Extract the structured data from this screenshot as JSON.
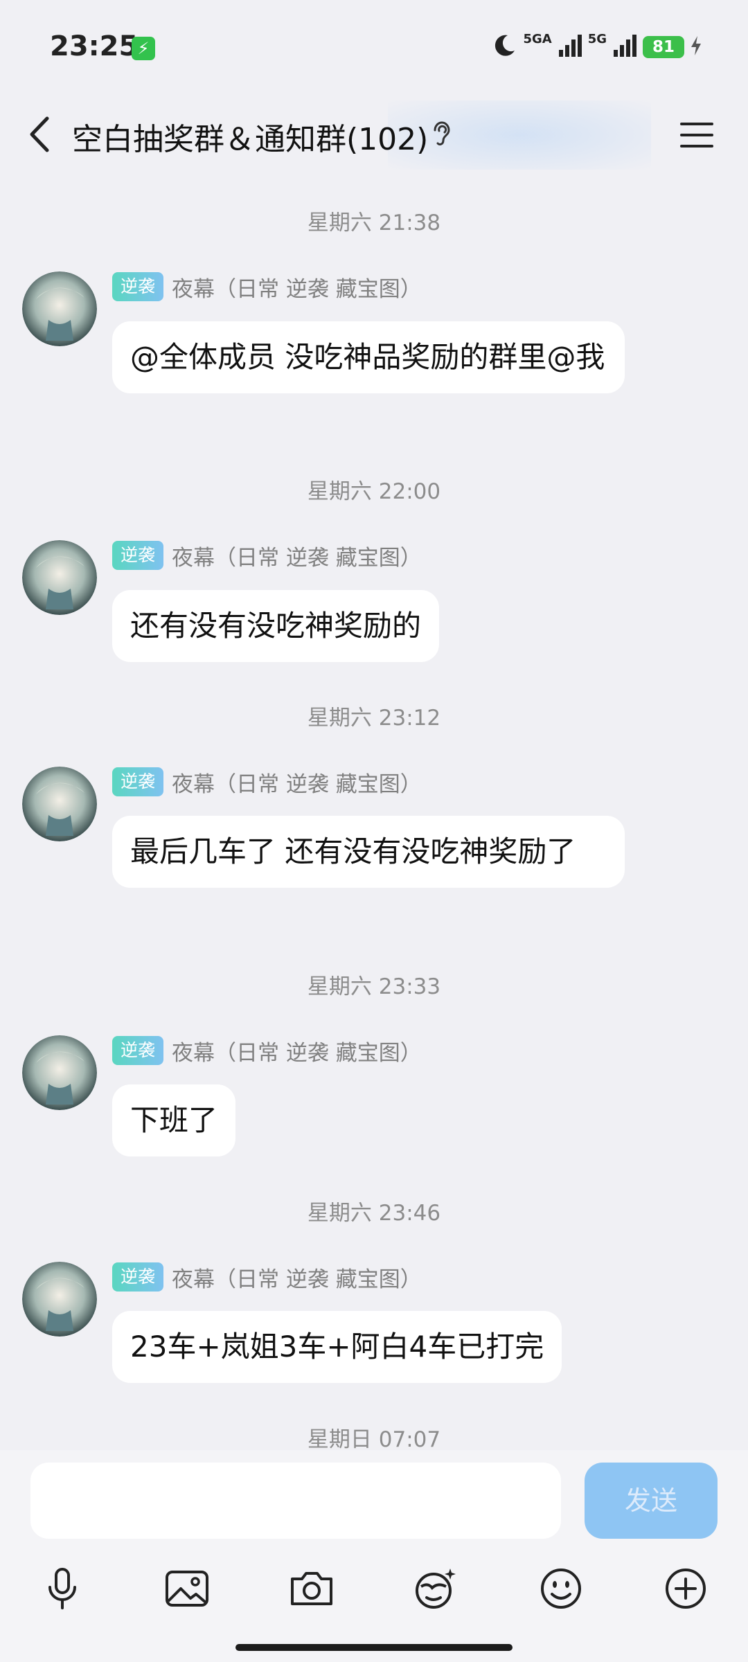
{
  "status_bar": {
    "time": "23:25",
    "signal1_label": "5GA",
    "signal2_label": "5G",
    "battery": "81"
  },
  "header": {
    "title": "空白抽奖群＆通知群(102)"
  },
  "messages": [
    {
      "timestamp": "星期六 21:38",
      "badge": "逆袭",
      "sender": "夜幕（日常 逆袭 藏宝图）",
      "text": "@全体成员 没吃神品奖励的群里@我"
    },
    {
      "timestamp": "星期六 22:00",
      "badge": "逆袭",
      "sender": "夜幕（日常 逆袭 藏宝图）",
      "text": "还有没有没吃神奖励的"
    },
    {
      "timestamp": "星期六 23:12",
      "badge": "逆袭",
      "sender": "夜幕（日常 逆袭 藏宝图）",
      "text": "最后几车了 还有没有没吃神奖励了"
    },
    {
      "timestamp": "星期六 23:33",
      "badge": "逆袭",
      "sender": "夜幕（日常 逆袭 藏宝图）",
      "text": "下班了"
    },
    {
      "timestamp": "星期六 23:46",
      "badge": "逆袭",
      "sender": "夜幕（日常 逆袭 藏宝图）",
      "text": "23车+岚姐3车+阿白4车已打完"
    }
  ],
  "last_timestamp": "星期日 07:07",
  "input": {
    "placeholder": "",
    "send_label": "发送"
  },
  "toolbar": [
    "mic-icon",
    "image-icon",
    "camera-icon",
    "emoji-sticker-icon",
    "smiley-icon",
    "plus-icon"
  ],
  "colors": {
    "background": "#f0f0f4",
    "bubble": "#ffffff",
    "badge": "#5ad6c0",
    "send_button": "#8ec5f3"
  }
}
